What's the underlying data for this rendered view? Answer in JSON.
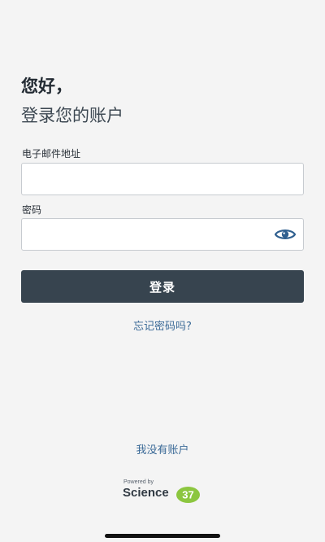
{
  "header": {
    "greeting": "您好，",
    "subtitle": "登录您的账户"
  },
  "form": {
    "email_label": "电子邮件地址",
    "email_value": "",
    "password_label": "密码",
    "password_value": "",
    "login_label": "登录",
    "show_password_icon": "eye-icon"
  },
  "links": {
    "forgot_password": "忘记密码吗?",
    "no_account": "我没有账户"
  },
  "brand": {
    "powered_by": "Powered by",
    "name": "Science",
    "number": "37",
    "badge_color": "#8cc63f"
  },
  "colors": {
    "background": "#f4f4f4",
    "button": "#37444f",
    "link": "#3b6a97",
    "icon": "#2f5f8f"
  }
}
